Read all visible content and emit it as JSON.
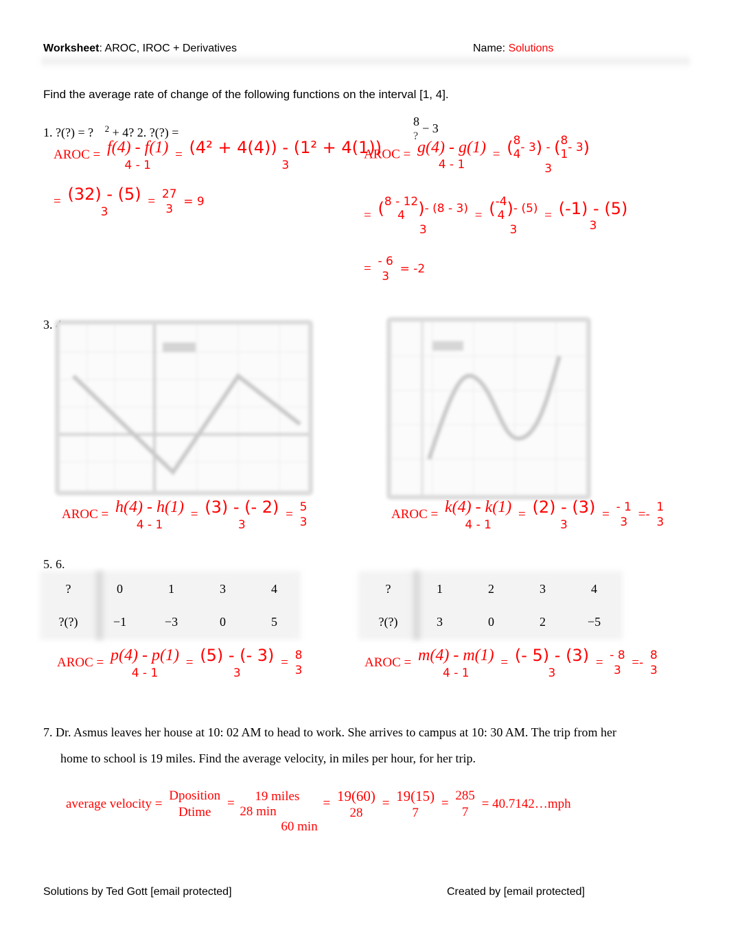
{
  "header": {
    "worksheet_label": "Worksheet",
    "title": ":  AROC, IROC + Derivatives",
    "name_label": "Name:",
    "name_value": "Solutions"
  },
  "instructions": "Find the average rate of change of the following functions on the interval [1, 4].",
  "colors": {
    "solution": "#ff0000",
    "text": "#000000",
    "blur_gray": "#dcdcdc"
  },
  "problem1_2_prompt": "1. ?(?) = ?",
  "problem1_2_sup": "2",
  "problem1_2_rest": " + 4? 2. ?(?) =",
  "problem2_fn": {
    "num": "8",
    "den": "?",
    "tail": "− 3"
  },
  "p1": {
    "label": "AROC =",
    "frac1_num": "f(4) - f(1)",
    "frac1_den": "4 - 1",
    "frac2_num": "(4² + 4(4)) - (1² + 4(1))",
    "frac2_den": "3",
    "frac3_num": "(32) - (5)",
    "frac3_den": "3",
    "frac4_num": "27",
    "frac4_den": "3",
    "result": "= 9"
  },
  "p2": {
    "label": "AROC =",
    "frac1_num": "g(4) - g(1)",
    "frac1_den": "4 - 1",
    "frac2_num_a_num": "8",
    "frac2_num_a_den": "4",
    "frac2_num_a_tail": "- 3",
    "frac2_num_b_num": "8",
    "frac2_num_b_den": "1",
    "frac2_num_b_tail": "- 3",
    "frac2_den": "3",
    "line2_a_inner_num": "8 - 12",
    "line2_a_inner_den": "4",
    "line2_a_tail": "- (8 - 3)",
    "line2_a_den": "3",
    "line2_b_inner_num": "-4",
    "line2_b_inner_den": "4",
    "line2_b_tail": "- (5)",
    "line2_b_den": "3",
    "line2_c_num": "(-1) - (5)",
    "line2_c_den": "3",
    "line3_num": "- 6",
    "line3_den": "3",
    "result": "= -2"
  },
  "labels_3_4": "3. 4.",
  "labels_5_6": "5. 6.",
  "p3": {
    "label": "AROC =",
    "frac1_num": "h(4) - h(1)",
    "frac1_den": "4 - 1",
    "frac2_num": "(3) - (- 2)",
    "frac2_den": "3",
    "frac3_num": "5",
    "frac3_den": "3"
  },
  "p4": {
    "label": "AROC =",
    "frac1_num": "k(4) - k(1)",
    "frac1_den": "4 - 1",
    "frac2_num": "(2) - (3)",
    "frac2_den": "3",
    "frac3_num": "- 1",
    "frac3_den": "3",
    "neg": "-",
    "frac4_num": "1",
    "frac4_den": "3"
  },
  "table5": {
    "row1": [
      "?",
      "0",
      "1",
      "3",
      "4"
    ],
    "row2": [
      "?(?)",
      "−1",
      "−3",
      "0",
      "5"
    ]
  },
  "table6": {
    "row1": [
      "?",
      "1",
      "2",
      "3",
      "4"
    ],
    "row2": [
      "?(?)",
      "3",
      "0",
      "2",
      "−5"
    ]
  },
  "p5": {
    "label": "AROC =",
    "frac1_num": "p(4) - p(1)",
    "frac1_den": "4 - 1",
    "frac2_num": "(5) - (- 3)",
    "frac2_den": "3",
    "frac3_num": "8",
    "frac3_den": "3"
  },
  "p6": {
    "label": "AROC =",
    "frac1_num": "m(4) - m(1)",
    "frac1_den": "4 - 1",
    "frac2_num": "(- 5) - (3)",
    "frac2_den": "3",
    "frac3_num": "- 8",
    "frac3_den": "3",
    "neg": "-",
    "frac4_num": "8",
    "frac4_den": "3"
  },
  "q7": {
    "line1": "7. Dr. Asmus leaves her house at 10: 02 AM to head to work. She arrives to campus at 10: 30 AM. The trip from her",
    "line2": "home to school is 19 miles. Find the average velocity, in miles per hour, for her trip.",
    "label": "average velocity =",
    "frac1_num": "Dposition",
    "frac1_den": "Dtime",
    "frac2_num": "19 miles",
    "frac2_den_a": "28 min",
    "frac2_den_b": "60 min",
    "frac3_num": "19(60)",
    "frac3_den": "28",
    "frac4_num": "19(15)",
    "frac4_den": "7",
    "frac5_num": "285",
    "frac5_den": "7",
    "result": "= 40.7142…mph"
  },
  "footer": {
    "left": "Solutions by Ted Gott [email protected]",
    "right": "Created by [email protected]"
  }
}
